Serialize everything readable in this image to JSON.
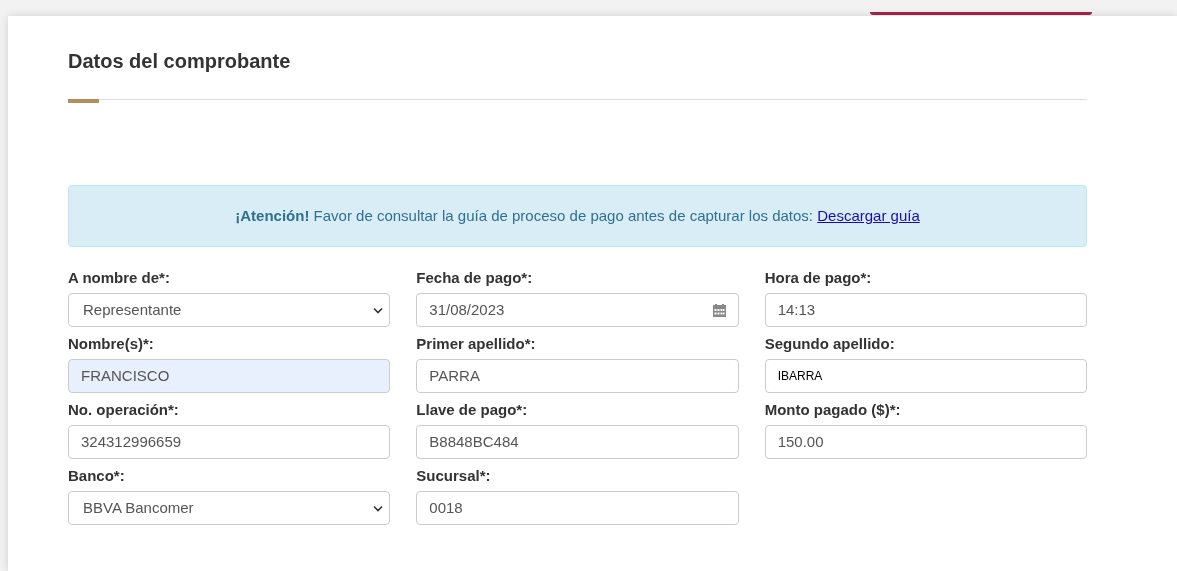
{
  "section": {
    "title": "Datos del comprobante"
  },
  "alert": {
    "text": "**¡Atención!** Favor de consultar la guía de proceso de pago antes de capturar los datos:",
    "link": "Descargar guía"
  },
  "fields": [
    {
      "label": "A nombre de*:",
      "kind": "select",
      "value": "Representante",
      "autofilled": false
    },
    {
      "label": "Fecha de pago*:",
      "kind": "date",
      "value": "31/08/2023",
      "autofilled": false
    },
    {
      "label": "Hora de pago*:",
      "kind": "text",
      "value": "14:13",
      "autofilled": false
    },
    {
      "label": "Nombre(s)*:",
      "kind": "text",
      "value": "FRANCISCO",
      "autofilled": true
    },
    {
      "label": "Primer apellido*:",
      "kind": "text",
      "value": "PARRA",
      "autofilled": false
    },
    {
      "label": "Segundo apellido:",
      "kind": "plain",
      "value": "IBARRA",
      "autofilled": false
    },
    {
      "label": "No. operación*:",
      "kind": "text",
      "value": "324312996659",
      "autofilled": false
    },
    {
      "label": "Llave de pago*:",
      "kind": "text",
      "value": "B8848BC484",
      "autofilled": false
    },
    {
      "label": "Monto pagado ($)*:",
      "kind": "text",
      "value": "150.00",
      "autofilled": false
    },
    {
      "label": "Banco*:",
      "kind": "select",
      "value": "BBVA Bancomer",
      "autofilled": false
    },
    {
      "label": "Sucursal*:",
      "kind": "text",
      "value": "0018",
      "autofilled": false
    }
  ]
}
